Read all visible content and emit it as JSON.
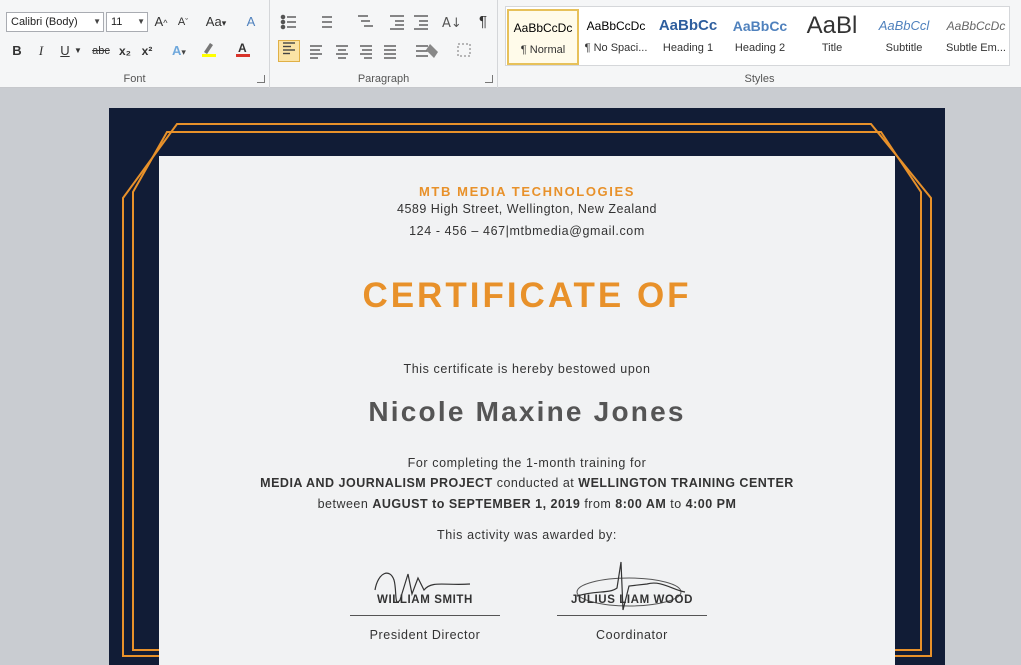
{
  "ribbon": {
    "font_group": {
      "label": "Font",
      "font_name": "Calibri (Body)",
      "font_size": "11",
      "bold": "B",
      "italic": "I",
      "underline": "U",
      "strike": "abc",
      "subscript": "x₂",
      "superscript": "x²",
      "grow": "A",
      "shrink": "A",
      "case": "Aa",
      "clear": "A"
    },
    "paragraph_group": {
      "label": "Paragraph",
      "pilcrow": "¶"
    },
    "styles_group": {
      "label": "Styles",
      "items": [
        {
          "sample": "AaBbCcDc",
          "name": "¶ Normal",
          "color": "#222222"
        },
        {
          "sample": "AaBbCcDc",
          "name": "¶ No Spaci...",
          "color": "#222222"
        },
        {
          "sample": "AaBbCc",
          "name": "Heading 1",
          "color": "#2e5e9e"
        },
        {
          "sample": "AaBbCc",
          "name": "Heading 2",
          "color": "#4f81bd"
        },
        {
          "sample": "AaBl",
          "name": "Title",
          "color": "#333333"
        },
        {
          "sample": "AaBbCcl",
          "name": "Subtitle",
          "color": "#4f81bd"
        },
        {
          "sample": "AaBbCcDc",
          "name": "Subtle Em...",
          "color": "#666666"
        }
      ]
    }
  },
  "certificate": {
    "company": "MTB MEDIA TECHNOLOGIES",
    "address": "4589 High Street, Wellington, New Zealand",
    "contact": "124 - 456 – 467|mtbmedia@gmail.com",
    "title": "CERTIFICATE OF",
    "bestowed": "This certificate is hereby bestowed upon",
    "recipient": "Nicole Maxine Jones",
    "line1": "For completing the 1-month training for",
    "project": "MEDIA AND JOURNALISM PROJECT",
    "conducted_at": "conducted at",
    "center": "WELLINGTON TRAINING CENTER",
    "between": "between",
    "dates": "AUGUST to SEPTEMBER 1, 2019",
    "from": "from",
    "start_time": "8:00 AM",
    "to": "to",
    "end_time": "4:00 PM",
    "awarded": "This activity was awarded by:",
    "signatories": [
      {
        "name": "WILLIAM SMITH",
        "role": "President Director"
      },
      {
        "name": "JULIUS LIAM WOOD",
        "role": "Coordinator"
      }
    ]
  },
  "colors": {
    "accent": "#e8912a",
    "frame": "#111c36",
    "paper": "#f1f2f3"
  }
}
